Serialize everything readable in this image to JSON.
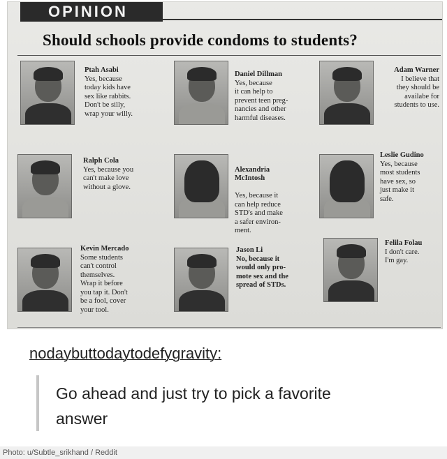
{
  "section_label": "OPINION",
  "headline": "Should schools provide condoms to students?",
  "students": [
    {
      "name": "Ptah Asabi",
      "text": "Yes, because\ntoday kids have\nsex like rabbits.\nDon't be silly,\nwrap your willy."
    },
    {
      "name": "Daniel Dillman",
      "text": "Yes, because\nit can help to\nprevent teen preg-\nnancies and other\nharmful diseases."
    },
    {
      "name": "Adam Warner",
      "text": "I believe that\nthey should be\navailabe for\nstudents to use."
    },
    {
      "name": "Ralph Cola",
      "text": "Yes, because you\ncan't make love\nwithout a glove."
    },
    {
      "name": "Alexandria\nMcIntosh",
      "text": "Yes, because it\ncan help reduce\nSTD's and make\na safer environ-\nment."
    },
    {
      "name": "Leslie Gudino",
      "text": "Yes, because\nmost students\nhave sex, so\njust make it\nsafe."
    },
    {
      "name": "Kevin Mercado",
      "text": "Some students\ncan't control\nthemselves.\nWrap it before\nyou tap it. Don't\nbe a fool, cover\nyour tool."
    },
    {
      "name": "Jason Li",
      "text": "No, because it\nwould only pro-\nmote sex and the\nspread of STDs."
    },
    {
      "name": "Felila Folau",
      "text": "I don't care.\nI'm gay."
    }
  ],
  "post": {
    "username": "nodaybuttodaytodefygravity:",
    "comment": "Go ahead and just try to pick a favorite answer"
  },
  "credit": "Photo: u/Subtle_srikhand / Reddit"
}
